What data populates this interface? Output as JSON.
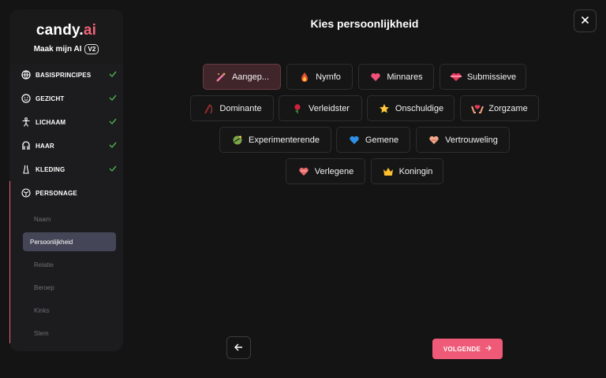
{
  "brand": {
    "logo_main": "candy.",
    "logo_accent": "ai",
    "subtitle": "Maak mijn AI",
    "version": "V2"
  },
  "sidebar": {
    "steps": [
      {
        "label": "BASISPRINCIPES",
        "icon": "globe-icon",
        "done": true
      },
      {
        "label": "GEZICHT",
        "icon": "smiley-icon",
        "done": true
      },
      {
        "label": "LICHAAM",
        "icon": "body-icon",
        "done": true
      },
      {
        "label": "HAAR",
        "icon": "hair-icon",
        "done": true
      },
      {
        "label": "KLEDING",
        "icon": "dress-icon",
        "done": true
      },
      {
        "label": "PERSONAGE",
        "icon": "persona-icon",
        "done": false
      }
    ],
    "persona_substeps": [
      "Naam",
      "Persoonlijkheid",
      "Relatie",
      "Beroep",
      "Kinks",
      "Stem"
    ],
    "active_substep": "Persoonlijkheid"
  },
  "main": {
    "title": "Kies persoonlijkheid",
    "options": [
      {
        "label": "Aangep...",
        "icon": "magic-wand-icon",
        "selected": true
      },
      {
        "label": "Nymfo",
        "icon": "fire-drop-icon",
        "selected": false
      },
      {
        "label": "Minnares",
        "icon": "heart-icon",
        "selected": false
      },
      {
        "label": "Submissieve",
        "icon": "heart-ribbon-icon",
        "selected": false
      },
      {
        "label": "Dominante",
        "icon": "whip-icon",
        "selected": false
      },
      {
        "label": "Verleidster",
        "icon": "rose-icon",
        "selected": false
      },
      {
        "label": "Onschuldige",
        "icon": "star-icon",
        "selected": false
      },
      {
        "label": "Zorgzame",
        "icon": "hands-heart-icon",
        "selected": false
      },
      {
        "label": "Experimenterende",
        "icon": "flask-icon",
        "selected": false
      },
      {
        "label": "Gemene",
        "icon": "blue-heart-icon",
        "selected": false
      },
      {
        "label": "Vertrouweling",
        "icon": "handshake-heart-icon",
        "selected": false
      },
      {
        "label": "Verlegene",
        "icon": "blush-heart-icon",
        "selected": false
      },
      {
        "label": "Koningin",
        "icon": "crown-icon",
        "selected": false
      }
    ],
    "next_label": "VOLGENDE"
  },
  "colors": {
    "accent": "#ee5a77",
    "selected_bg": "#40262b",
    "background": "#141414"
  }
}
